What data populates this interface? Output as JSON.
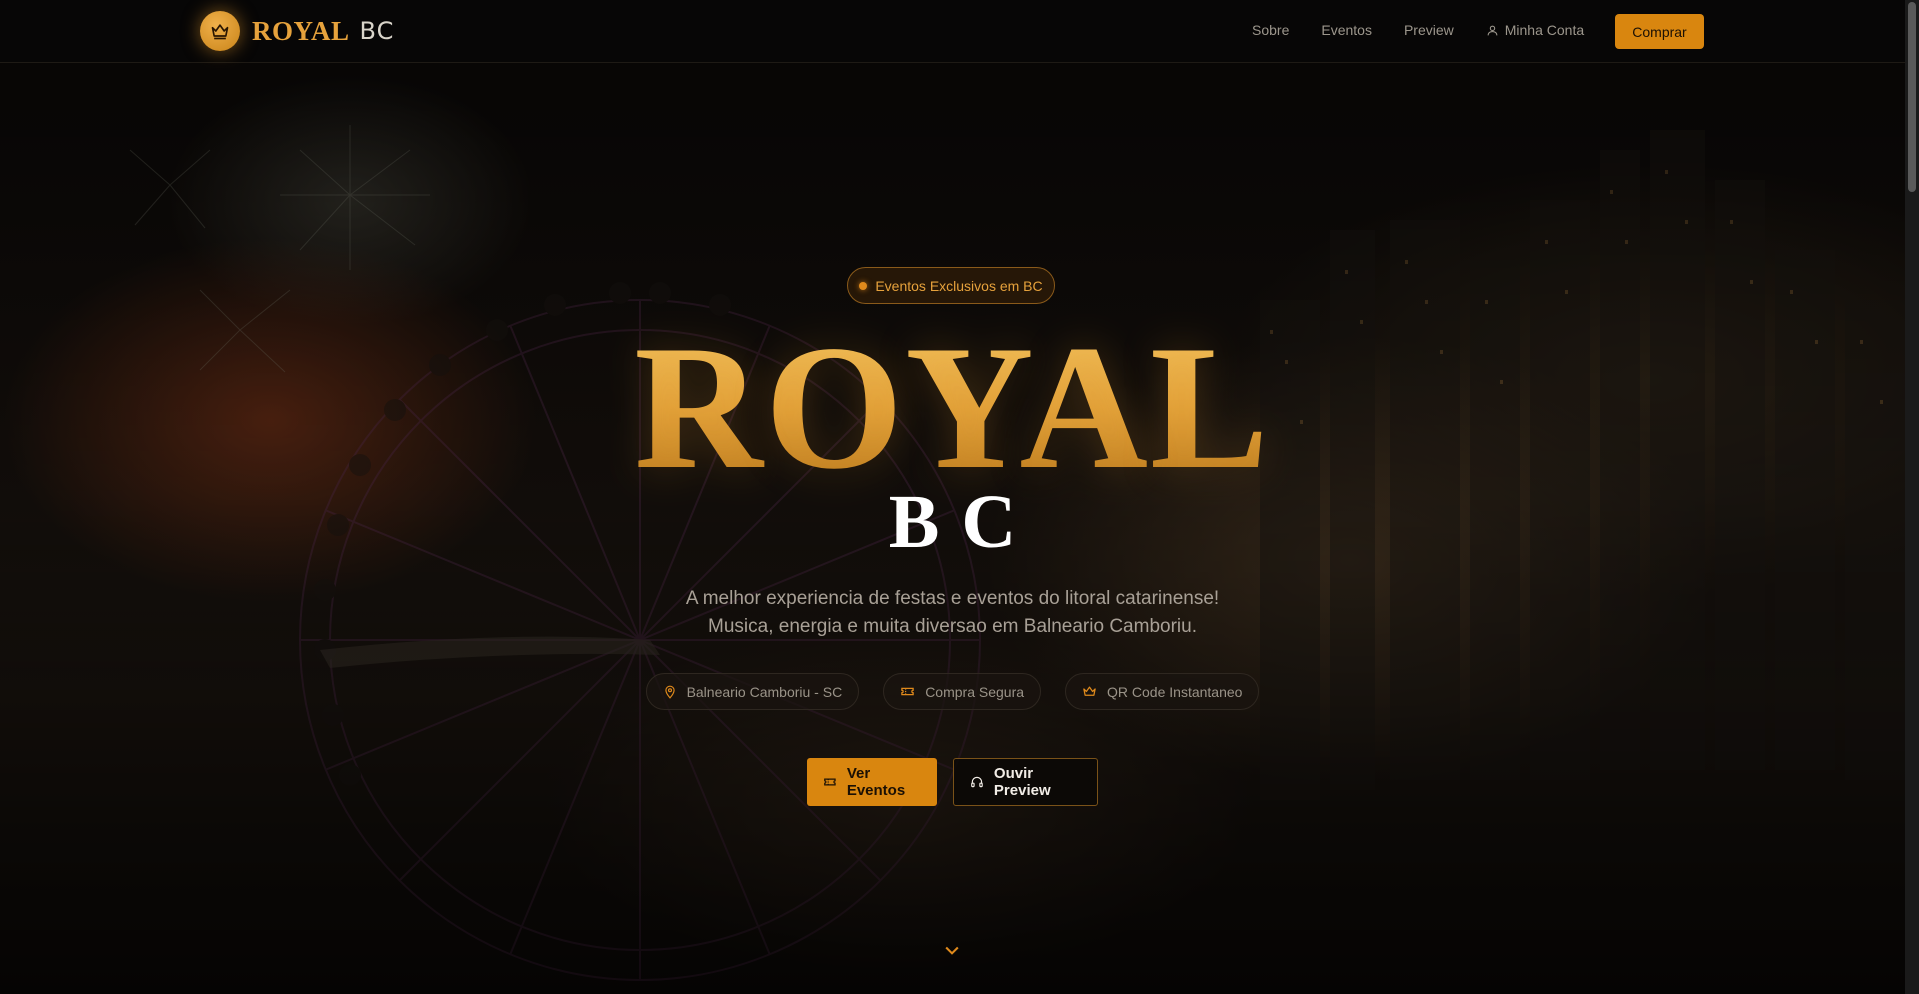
{
  "brand": {
    "name_primary": "ROYAL",
    "name_secondary": "BC",
    "icon": "crown-icon"
  },
  "nav": {
    "links": [
      "Sobre",
      "Eventos",
      "Preview",
      "Minha Conta"
    ],
    "account_icon": "user-icon",
    "cta_label": "Comprar"
  },
  "hero": {
    "eyebrow": "Eventos Exclusivos em BC",
    "title": "ROYAL",
    "subtitle": "BC",
    "tagline_line1": "A melhor experiencia de festas e eventos do litoral catarinense!",
    "tagline_line2": "Musica, energia e muita diversao em Balneario Camboriu.",
    "features": [
      {
        "label": "Balneario Camboriu - SC",
        "icon": "map-pin-icon"
      },
      {
        "label": "Compra Segura",
        "icon": "ticket-icon"
      },
      {
        "label": "QR Code Instantaneo",
        "icon": "crown-icon"
      }
    ],
    "primary_button": "Ver Eventos",
    "secondary_button": "Ouvir Preview"
  },
  "colors": {
    "accent": "#d9860f",
    "gold": "#e6a23c",
    "background": "#0b0908"
  }
}
